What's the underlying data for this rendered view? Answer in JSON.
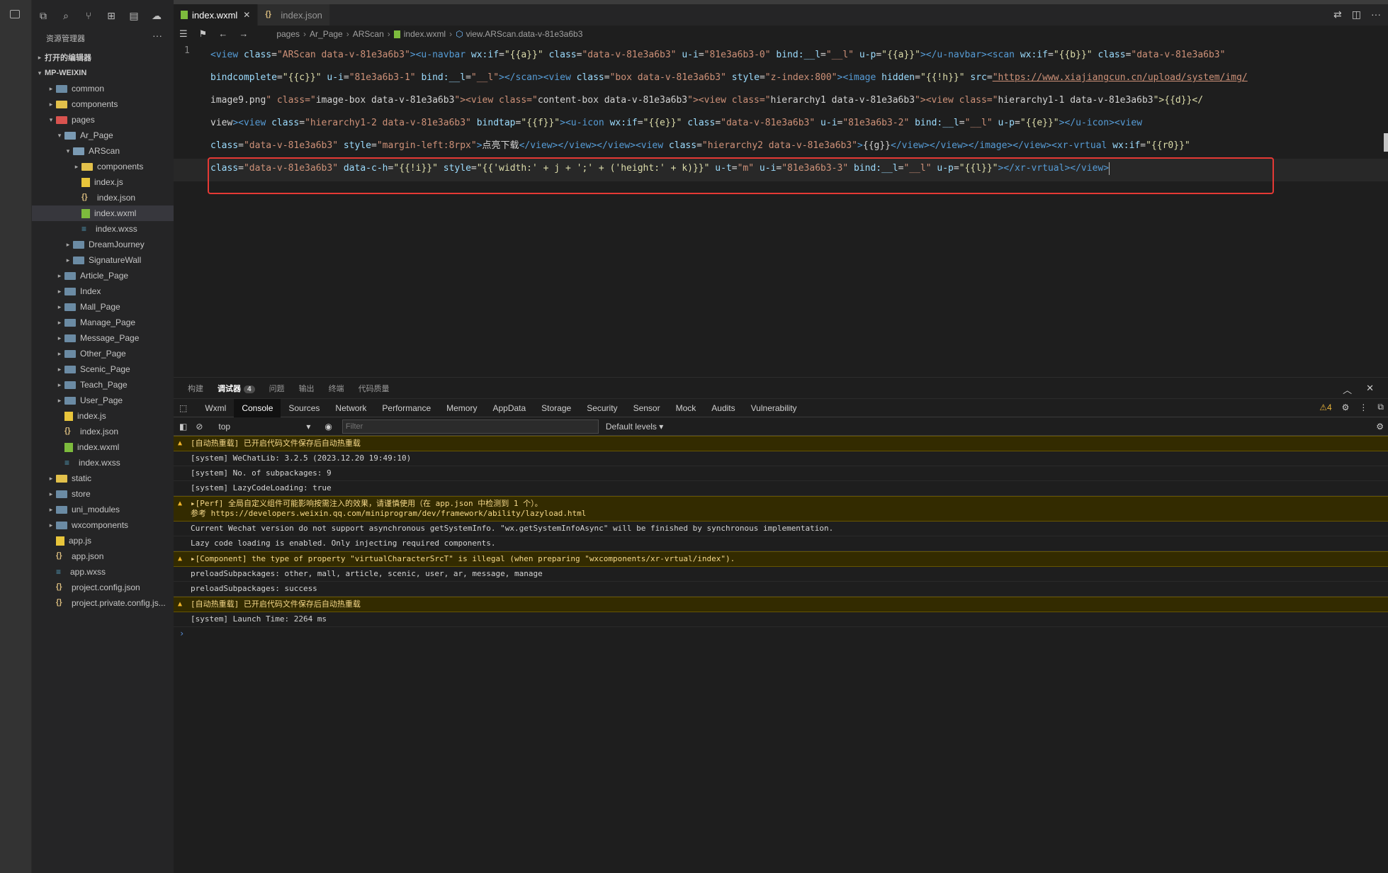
{
  "sidebar": {
    "title": "资源管理器",
    "open_editors": "打开的编辑器",
    "project": "MP-WEIXIN",
    "tree": [
      {
        "label": "common",
        "depth": 1,
        "type": "folder",
        "twisty": "▸"
      },
      {
        "label": "components",
        "depth": 1,
        "type": "folder-yellow",
        "twisty": "▸"
      },
      {
        "label": "pages",
        "depth": 1,
        "type": "folder-red",
        "twisty": "▾"
      },
      {
        "label": "Ar_Page",
        "depth": 2,
        "type": "folder-open",
        "twisty": "▾"
      },
      {
        "label": "ARScan",
        "depth": 3,
        "type": "folder-open",
        "twisty": "▾"
      },
      {
        "label": "components",
        "depth": 4,
        "type": "folder-yellow",
        "twisty": "▸"
      },
      {
        "label": "index.js",
        "depth": 4,
        "type": "js",
        "twisty": ""
      },
      {
        "label": "index.json",
        "depth": 4,
        "type": "json",
        "twisty": ""
      },
      {
        "label": "index.wxml",
        "depth": 4,
        "type": "wxml",
        "twisty": "",
        "selected": true
      },
      {
        "label": "index.wxss",
        "depth": 4,
        "type": "wxss",
        "twisty": ""
      },
      {
        "label": "DreamJourney",
        "depth": 3,
        "type": "folder",
        "twisty": "▸"
      },
      {
        "label": "SignatureWall",
        "depth": 3,
        "type": "folder",
        "twisty": "▸"
      },
      {
        "label": "Article_Page",
        "depth": 2,
        "type": "folder",
        "twisty": "▸"
      },
      {
        "label": "Index",
        "depth": 2,
        "type": "folder",
        "twisty": "▸"
      },
      {
        "label": "Mall_Page",
        "depth": 2,
        "type": "folder",
        "twisty": "▸"
      },
      {
        "label": "Manage_Page",
        "depth": 2,
        "type": "folder",
        "twisty": "▸"
      },
      {
        "label": "Message_Page",
        "depth": 2,
        "type": "folder",
        "twisty": "▸"
      },
      {
        "label": "Other_Page",
        "depth": 2,
        "type": "folder",
        "twisty": "▸"
      },
      {
        "label": "Scenic_Page",
        "depth": 2,
        "type": "folder",
        "twisty": "▸"
      },
      {
        "label": "Teach_Page",
        "depth": 2,
        "type": "folder",
        "twisty": "▸"
      },
      {
        "label": "User_Page",
        "depth": 2,
        "type": "folder",
        "twisty": "▸"
      },
      {
        "label": "index.js",
        "depth": 2,
        "type": "js",
        "twisty": ""
      },
      {
        "label": "index.json",
        "depth": 2,
        "type": "json",
        "twisty": ""
      },
      {
        "label": "index.wxml",
        "depth": 2,
        "type": "wxml",
        "twisty": ""
      },
      {
        "label": "index.wxss",
        "depth": 2,
        "type": "wxss",
        "twisty": ""
      },
      {
        "label": "static",
        "depth": 1,
        "type": "folder-yellow",
        "twisty": "▸"
      },
      {
        "label": "store",
        "depth": 1,
        "type": "folder",
        "twisty": "▸"
      },
      {
        "label": "uni_modules",
        "depth": 1,
        "type": "folder",
        "twisty": "▸"
      },
      {
        "label": "wxcomponents",
        "depth": 1,
        "type": "folder",
        "twisty": "▸"
      },
      {
        "label": "app.js",
        "depth": 1,
        "type": "js",
        "twisty": ""
      },
      {
        "label": "app.json",
        "depth": 1,
        "type": "json",
        "twisty": ""
      },
      {
        "label": "app.wxss",
        "depth": 1,
        "type": "wxss",
        "twisty": ""
      },
      {
        "label": "project.config.json",
        "depth": 1,
        "type": "json",
        "twisty": ""
      },
      {
        "label": "project.private.config.js...",
        "depth": 1,
        "type": "json",
        "twisty": ""
      }
    ]
  },
  "editor": {
    "tabs": [
      {
        "label": "index.wxml",
        "active": true,
        "close": "✕"
      },
      {
        "label": "index.json",
        "active": false,
        "close": ""
      }
    ],
    "breadcrumb": [
      "pages",
      "Ar_Page",
      "ARScan",
      "index.wxml",
      "view.ARScan.data-v-81e3a6b3"
    ],
    "line_number": "1",
    "lines": [
      "<view class=\"ARScan data-v-81e3a6b3\"><u-navbar wx:if=\"{{a}}\" class=\"data-v-81e3a6b3\" u-i=\"81e3a6b3-0\" bind:__l=\"__l\" u-p=\"{{a}}\"></u-navbar><scan wx:if=\"{{b}}\" class=\"data-v-81e3a6b3\"",
      "bindcomplete=\"{{c}}\" u-i=\"81e3a6b3-1\" bind:__l=\"__l\"></scan><view class=\"box data-v-81e3a6b3\" style=\"z-index:800\"><image hidden=\"{{!h}}\" src=\"https://www.xiajiangcun.cn/upload/system/img/",
      "image9.png\" class=\"image-box data-v-81e3a6b3\"><view class=\"content-box data-v-81e3a6b3\"><view class=\"hierarchy1 data-v-81e3a6b3\"><view class=\"hierarchy1-1 data-v-81e3a6b3\">{{d}}</",
      "view><view class=\"hierarchy1-2 data-v-81e3a6b3\" bindtap=\"{{f}}\"><u-icon wx:if=\"{{e}}\" class=\"data-v-81e3a6b3\" u-i=\"81e3a6b3-2\" bind:__l=\"__l\" u-p=\"{{e}}\"></u-icon><view",
      "class=\"data-v-81e3a6b3\" style=\"margin-left:8rpx\">点亮下载</view></view></view><view class=\"hierarchy2 data-v-81e3a6b3\">{{g}}</view></view></image></view><xr-vrtual wx:if=\"{{r0}}\"",
      "class=\"data-v-81e3a6b3\" data-c-h=\"{{!i}}\" style=\"{{'width:' + j + ';' + ('height:' + k)}}\" u-t=\"m\" u-i=\"81e3a6b3-3\" bind:__l=\"__l\" u-p=\"{{l}}\"></xr-vrtual></view>"
    ]
  },
  "panel": {
    "tabs": [
      "构建",
      "调试器",
      "问题",
      "输出",
      "终端",
      "代码质量"
    ],
    "debugger_badge": "4",
    "devtools_tabs": [
      "Wxml",
      "Console",
      "Sources",
      "Network",
      "Performance",
      "Memory",
      "AppData",
      "Storage",
      "Security",
      "Sensor",
      "Mock",
      "Audits",
      "Vulnerability"
    ],
    "warn_count": "⚠4",
    "context": "top",
    "filter_placeholder": "Filter",
    "levels": "Default levels ▾",
    "messages": [
      {
        "text": "[自动热重载] 已开启代码文件保存后自动热重载",
        "warn": true
      },
      {
        "text": "[system] WeChatLib: 3.2.5 (2023.12.20 19:49:10)",
        "warn": false
      },
      {
        "text": "[system] No. of subpackages: 9",
        "warn": false
      },
      {
        "text": "[system] LazyCodeLoading: true",
        "warn": false
      },
      {
        "text": "▸[Perf] 全局自定义组件可能影响按需注入的效果，请谨慎使用（在 app.json 中检测到 1 个）。\n参考 https://developers.weixin.qq.com/miniprogram/dev/framework/ability/lazyload.html",
        "warn": true
      },
      {
        "text": "Current Wechat version do not support asynchronous getSystemInfo. \"wx.getSystemInfoAsync\" will be finished by synchronous implementation.",
        "warn": false
      },
      {
        "text": "Lazy code loading is enabled. Only injecting required components.",
        "warn": false
      },
      {
        "text": "▸[Component] the type of property \"virtualCharacterSrcT\" is illegal (when preparing \"wxcomponents/xr-vrtual/index\").",
        "warn": true
      },
      {
        "text": "preloadSubpackages: other, mall, article, scenic, user, ar, message, manage",
        "warn": false
      },
      {
        "text": "preloadSubpackages: success",
        "warn": false
      },
      {
        "text": "[自动热重载] 已开启代码文件保存后自动热重载",
        "warn": true
      },
      {
        "text": "[system] Launch Time: 2264 ms",
        "warn": false
      }
    ],
    "prompt": "›"
  },
  "colors": {
    "accent_box": "#e53935",
    "warning_bg": "#332b00"
  }
}
